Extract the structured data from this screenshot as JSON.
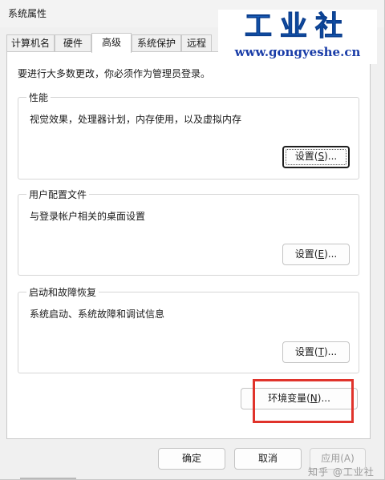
{
  "window": {
    "title": "系统属性"
  },
  "tabs": [
    {
      "label": "计算机名"
    },
    {
      "label": "硬件"
    },
    {
      "label": "高级"
    },
    {
      "label": "系统保护"
    },
    {
      "label": "远程"
    }
  ],
  "intro": "要进行大多数更改，你必须作为管理员登录。",
  "performance": {
    "title": "性能",
    "desc": "视觉效果，处理器计划，内存使用，以及虚拟内存",
    "button": {
      "pre": "设置(",
      "key": "S",
      "post": ")..."
    }
  },
  "user_profiles": {
    "title": "用户配置文件",
    "desc": "与登录帐户相关的桌面设置",
    "button": {
      "pre": "设置(",
      "key": "E",
      "post": ")..."
    }
  },
  "startup_recovery": {
    "title": "启动和故障恢复",
    "desc": "系统启动、系统故障和调试信息",
    "button": {
      "pre": "设置(",
      "key": "T",
      "post": ")..."
    }
  },
  "env_vars_button": {
    "pre": "环境变量(",
    "key": "N",
    "post": ")..."
  },
  "footer": {
    "ok": "确定",
    "cancel": "取消",
    "apply": "应用(A)"
  },
  "watermark": {
    "title": "工业社",
    "url": "www.gongyeshe.cn",
    "bottom": "知乎 @工业社"
  },
  "colors": {
    "highlight": "#e0332b",
    "logo_blue": "#1c6fd1"
  }
}
